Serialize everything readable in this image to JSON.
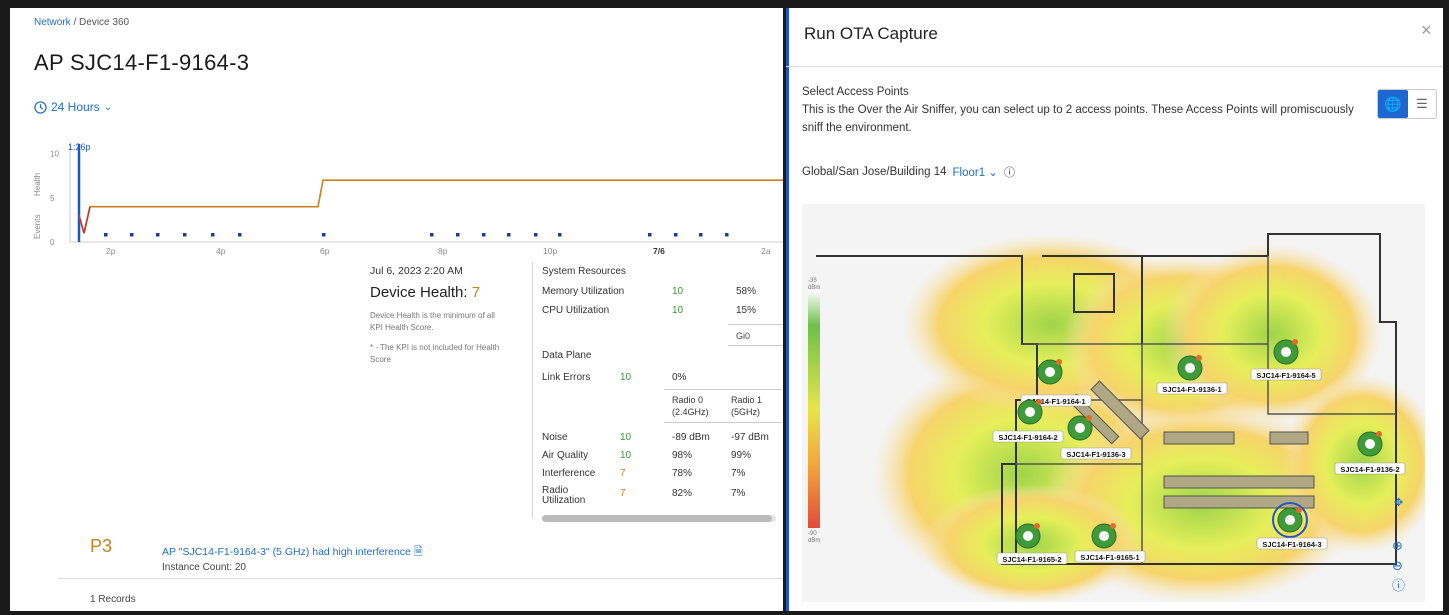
{
  "breadcrumb": {
    "link": "Network",
    "separator": "/",
    "current": "Device 360"
  },
  "page_title": "AP SJC14-F1-9164-3",
  "time_selector": {
    "label": "24 Hours",
    "icon": "clock-icon"
  },
  "chart_data": {
    "type": "line",
    "title": "",
    "ylabel": "Health",
    "events_label": "Events",
    "ylim": [
      0,
      10
    ],
    "y_ticks": [
      "10",
      "5",
      "0"
    ],
    "x_ticks": [
      "2p",
      "4p",
      "6p",
      "8p",
      "10p",
      "7/6",
      "2a"
    ],
    "cursor_label": "1:26p",
    "series": [
      {
        "x": [
          "1:26p",
          "1:32p",
          "1:40p",
          "5:55p",
          "6:00p",
          "3:00a"
        ],
        "values": [
          3,
          1,
          4,
          4,
          7,
          7
        ]
      }
    ],
    "event_markers": 17
  },
  "tooltip": {
    "date": "Jul 6, 2023 2:20 AM",
    "device_health_label": "Device Health:",
    "device_health_value": "7",
    "note1": "Device Health is the minimum of all KPI Health Score.",
    "note2": "* - The KPI is not included for Health Score",
    "system_resources": {
      "title": "System Resources",
      "rows": [
        {
          "name": "Memory Utilization",
          "score": "10",
          "value": "58%"
        },
        {
          "name": "CPU Utilization",
          "score": "10",
          "value": "15%"
        }
      ],
      "interface": "Gi0"
    },
    "data_plane": {
      "title": "Data Plane",
      "link_errors": {
        "name": "Link Errors",
        "score": "10",
        "value": "0%"
      },
      "radio0_header": "Radio 0",
      "radio0_band": "(2.4GHz)",
      "radio1_header": "Radio 1",
      "radio1_band": "(5GHz)",
      "rows": [
        {
          "name": "Noise",
          "score": "10",
          "r0": "-89 dBm",
          "r1": "-97 dBm"
        },
        {
          "name": "Air Quality",
          "score": "10",
          "r0": "98%",
          "r1": "99%"
        },
        {
          "name": "Interference",
          "score": "7",
          "r0": "78%",
          "r1": "7%"
        },
        {
          "name": "Radio Utilization",
          "score": "7",
          "r0": "82%",
          "r1": "7%"
        }
      ]
    }
  },
  "issue": {
    "priority": "P3",
    "message": "AP \"SJC14-F1-9164-3\" (5 GHz) had high interference",
    "instance_count": "Instance Count: 20"
  },
  "records": "1 Records",
  "ota_panel": {
    "title": "Run OTA Capture",
    "close_icon": "close-icon",
    "select_label": "Select Access Points",
    "description": "This is the Over the Air Sniffer, you can select up to 2 access points. These Access Points will promiscuously sniff the environment.",
    "view_toggle": {
      "active": "globe-icon",
      "inactive": "list-icon"
    },
    "location_path": "Global/San Jose/Building 14",
    "floor": "Floor1",
    "legend_top": "-35",
    "legend_top_unit": "dBm",
    "legend_bottom": "-90",
    "legend_bottom_unit": "dBm",
    "access_points": [
      {
        "name": "SJC14-F1-9164-5"
      },
      {
        "name": "SJC14-F1-9136-1"
      },
      {
        "name": "SJC14-F1-9164-1"
      },
      {
        "name": "SJC14-F1-9164-2"
      },
      {
        "name": "SJC14-F1-9136-3"
      },
      {
        "name": "SJC14-F1-9136-2"
      },
      {
        "name": "SJC14-F1-9164-3"
      },
      {
        "name": "SJC14-F1-9165-2"
      },
      {
        "name": "SJC14-F1-9165-1"
      }
    ]
  },
  "colors": {
    "brand_blue": "#1f6fc0",
    "health_line": "#c8821e",
    "panel_border": "#1f57c5",
    "good": "#3a9b3a"
  }
}
